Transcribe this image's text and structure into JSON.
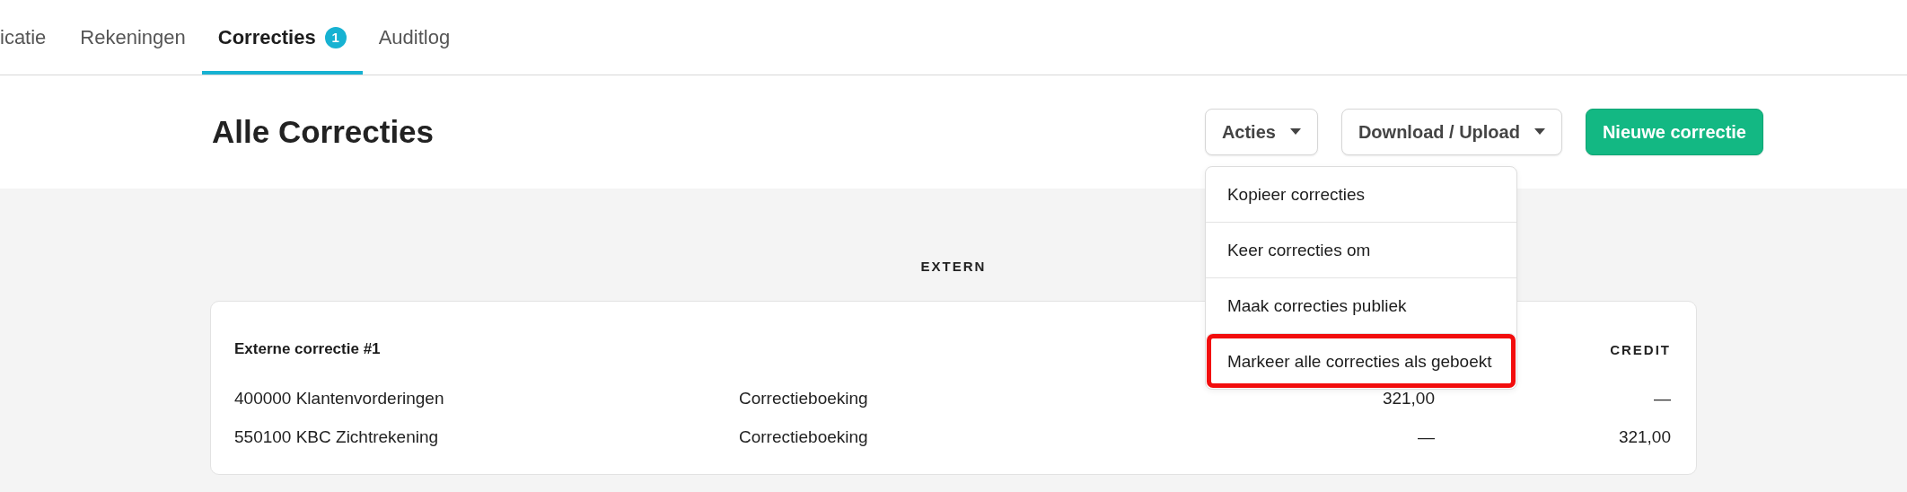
{
  "tabs": [
    {
      "label": "icatie",
      "selected": false
    },
    {
      "label": "Rekeningen",
      "selected": false
    },
    {
      "label": "Correcties",
      "selected": true,
      "badge": "1"
    },
    {
      "label": "Auditlog",
      "selected": false
    }
  ],
  "page": {
    "title": "Alle Correcties"
  },
  "toolbar": {
    "buttons": [
      {
        "label": "Acties",
        "kind": "dropdown"
      },
      {
        "label": "Download / Upload",
        "kind": "dropdown"
      },
      {
        "label": "Nieuwe correctie",
        "kind": "primary"
      }
    ]
  },
  "actions_menu": {
    "items": [
      {
        "label": "Kopieer correcties",
        "highlighted": false
      },
      {
        "label": "Keer correcties om",
        "highlighted": false
      },
      {
        "label": "Maak correcties publiek",
        "highlighted": false
      },
      {
        "label": "Markeer alle correcties als geboekt",
        "highlighted": true
      }
    ]
  },
  "section": {
    "title": "EXTERN"
  },
  "card": {
    "title": "Externe correctie #1",
    "column_4_header": "CREDIT",
    "rows": [
      {
        "column_1": "400000 Klantenvorderingen",
        "column_2": "Correctieboeking",
        "column_3": "321,00",
        "column_4": "—"
      },
      {
        "column_1": "550100 KBC Zichtrekening",
        "column_2": "Correctieboeking",
        "column_3": "—",
        "column_4": "321,00"
      }
    ]
  }
}
